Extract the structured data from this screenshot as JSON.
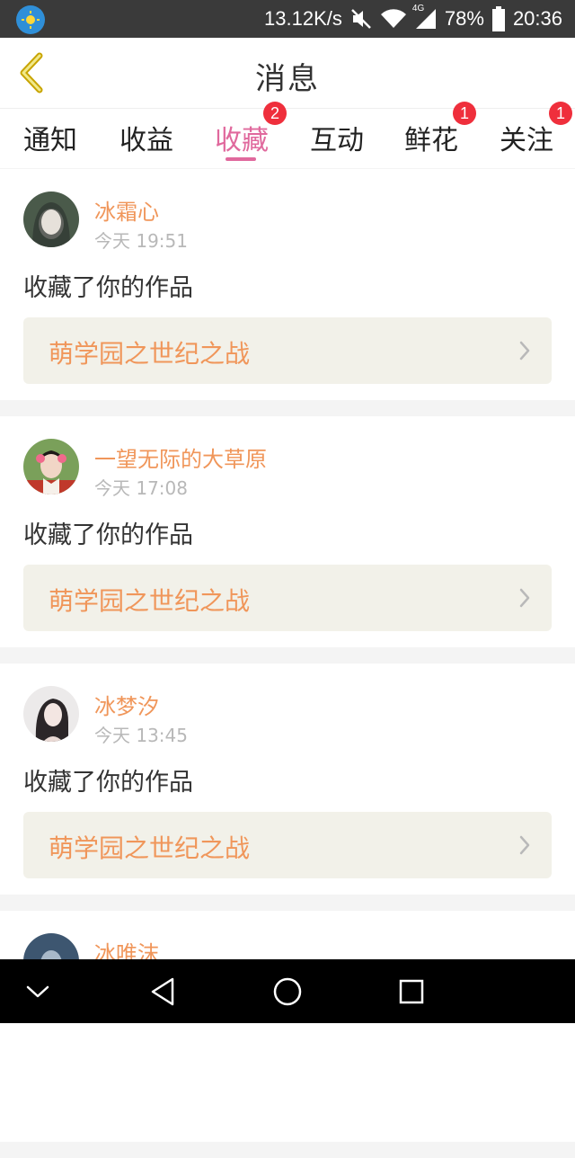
{
  "status_bar": {
    "speed": "13.12K/s",
    "network_type": "4G",
    "battery": "78%",
    "time": "20:36",
    "icons": [
      "weather-app-icon",
      "mute-icon",
      "wifi-icon",
      "signal-icon",
      "battery-icon"
    ]
  },
  "header": {
    "title": "消息",
    "back_icon": "chevron-left-icon"
  },
  "tabs": [
    {
      "label": "通知",
      "badge": ""
    },
    {
      "label": "收益",
      "badge": ""
    },
    {
      "label": "收藏",
      "badge": "2",
      "active": true
    },
    {
      "label": "互动",
      "badge": ""
    },
    {
      "label": "鲜花",
      "badge": "1"
    },
    {
      "label": "关注",
      "badge": "1"
    }
  ],
  "colors": {
    "accent": "#e0699d",
    "username": "#f0965a",
    "badge": "#ef2f3c",
    "work_bg": "#f2f1e9"
  },
  "messages": [
    {
      "username": "冰霜心",
      "time": "今天 19:51",
      "action": "收藏了你的作品",
      "work_title": "萌学园之世纪之战"
    },
    {
      "username": "一望无际的大草原",
      "time": "今天 17:08",
      "action": "收藏了你的作品",
      "work_title": "萌学园之世纪之战"
    },
    {
      "username": "冰梦汐",
      "time": "今天 13:45",
      "action": "收藏了你的作品",
      "work_title": "萌学园之世纪之战"
    },
    {
      "username": "冰唯沫"
    }
  ],
  "nav_bar": {
    "icons": [
      "chevron-down-icon",
      "back-triangle-icon",
      "home-circle-icon",
      "recent-square-icon"
    ]
  }
}
